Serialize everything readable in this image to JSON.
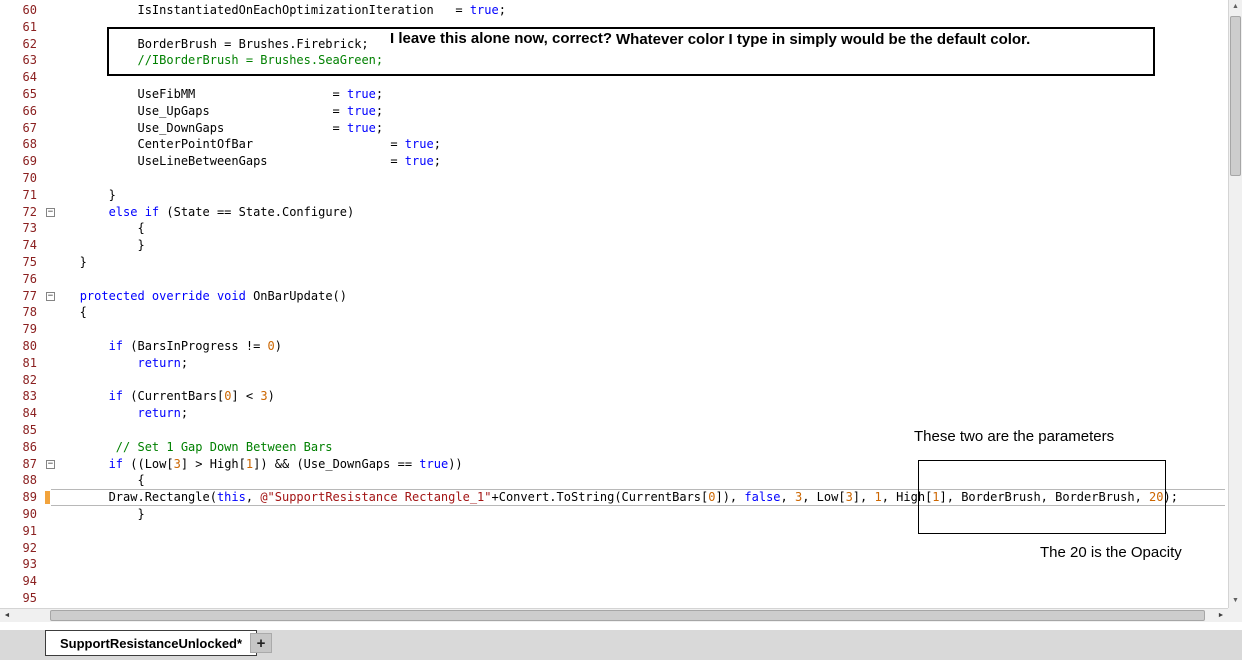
{
  "colors": {
    "keyword": "#0000ff",
    "comment": "#008000",
    "string": "#a31515",
    "number": "#cc6600",
    "line_number": "#8b2020",
    "change_marker": "#f2a33c",
    "annotation_border": "#000000"
  },
  "icons": {
    "up": "▲",
    "down": "▼",
    "left": "◄",
    "right": "►",
    "fold_collapse": "−"
  },
  "tab_bar": {
    "tab_label": "SupportResistanceUnlocked*",
    "new_tab_label": "+"
  },
  "annotations": {
    "note1a": "I leave this alone now, correct?",
    "note1b": "Whatever color I type in simply would be the default color.",
    "note2": "These two are the parameters",
    "note3": "The 20 is the Opacity"
  },
  "editor": {
    "current_line": 89,
    "changed_line": 89,
    "lines": [
      {
        "n": 60,
        "segs": [
          [
            "           IsInstantiatedOnEachOptimizationIteration   = ",
            "d"
          ],
          [
            "true",
            "k"
          ],
          [
            ";",
            "d"
          ]
        ]
      },
      {
        "n": 61,
        "segs": []
      },
      {
        "n": 62,
        "segs": [
          [
            "           BorderBrush = Brushes.Firebrick;",
            "d"
          ]
        ]
      },
      {
        "n": 63,
        "segs": [
          [
            "           ",
            "d"
          ],
          [
            "//IBorderBrush = Brushes.SeaGreen;",
            "c"
          ]
        ]
      },
      {
        "n": 64,
        "segs": []
      },
      {
        "n": 65,
        "segs": [
          [
            "           UseFibMM                   = ",
            "d"
          ],
          [
            "true",
            "k"
          ],
          [
            ";",
            "d"
          ]
        ]
      },
      {
        "n": 66,
        "segs": [
          [
            "           Use_UpGaps                 = ",
            "d"
          ],
          [
            "true",
            "k"
          ],
          [
            ";",
            "d"
          ]
        ]
      },
      {
        "n": 67,
        "segs": [
          [
            "           Use_DownGaps               = ",
            "d"
          ],
          [
            "true",
            "k"
          ],
          [
            ";",
            "d"
          ]
        ]
      },
      {
        "n": 68,
        "segs": [
          [
            "           CenterPointOfBar                   = ",
            "d"
          ],
          [
            "true",
            "k"
          ],
          [
            ";",
            "d"
          ]
        ]
      },
      {
        "n": 69,
        "segs": [
          [
            "           UseLineBetweenGaps                 = ",
            "d"
          ],
          [
            "true",
            "k"
          ],
          [
            ";",
            "d"
          ]
        ]
      },
      {
        "n": 70,
        "segs": []
      },
      {
        "n": 71,
        "segs": [
          [
            "       }",
            "d"
          ]
        ]
      },
      {
        "n": 72,
        "fold": true,
        "segs": [
          [
            "       ",
            "d"
          ],
          [
            "else if",
            "k"
          ],
          [
            " (State == State.Configure)",
            "d"
          ]
        ]
      },
      {
        "n": 73,
        "segs": [
          [
            "           {",
            "d"
          ]
        ]
      },
      {
        "n": 74,
        "segs": [
          [
            "           }",
            "d"
          ]
        ]
      },
      {
        "n": 75,
        "segs": [
          [
            "   }",
            "d"
          ]
        ]
      },
      {
        "n": 76,
        "segs": []
      },
      {
        "n": 77,
        "fold": true,
        "segs": [
          [
            "   ",
            "d"
          ],
          [
            "protected override void",
            "k"
          ],
          [
            " OnBarUpdate()",
            "d"
          ]
        ]
      },
      {
        "n": 78,
        "segs": [
          [
            "   {",
            "d"
          ]
        ]
      },
      {
        "n": 79,
        "segs": []
      },
      {
        "n": 80,
        "segs": [
          [
            "       ",
            "d"
          ],
          [
            "if",
            "k"
          ],
          [
            " (BarsInProgress != ",
            "d"
          ],
          [
            "0",
            "n"
          ],
          [
            ")",
            "d"
          ]
        ]
      },
      {
        "n": 81,
        "segs": [
          [
            "           ",
            "d"
          ],
          [
            "return",
            "k"
          ],
          [
            ";",
            "d"
          ]
        ]
      },
      {
        "n": 82,
        "segs": []
      },
      {
        "n": 83,
        "segs": [
          [
            "       ",
            "d"
          ],
          [
            "if",
            "k"
          ],
          [
            " (CurrentBars[",
            "d"
          ],
          [
            "0",
            "n"
          ],
          [
            "] < ",
            "d"
          ],
          [
            "3",
            "n"
          ],
          [
            ")",
            "d"
          ]
        ]
      },
      {
        "n": 84,
        "segs": [
          [
            "           ",
            "d"
          ],
          [
            "return",
            "k"
          ],
          [
            ";",
            "d"
          ]
        ]
      },
      {
        "n": 85,
        "segs": []
      },
      {
        "n": 86,
        "segs": [
          [
            "        ",
            "d"
          ],
          [
            "// Set 1 Gap Down Between Bars",
            "c"
          ]
        ]
      },
      {
        "n": 87,
        "fold": true,
        "segs": [
          [
            "       ",
            "d"
          ],
          [
            "if",
            "k"
          ],
          [
            " ((Low[",
            "d"
          ],
          [
            "3",
            "n"
          ],
          [
            "] > High[",
            "d"
          ],
          [
            "1",
            "n"
          ],
          [
            "]) && (Use_DownGaps == ",
            "d"
          ],
          [
            "true",
            "k"
          ],
          [
            "))",
            "d"
          ]
        ]
      },
      {
        "n": 88,
        "segs": [
          [
            "           {",
            "d"
          ]
        ]
      },
      {
        "n": 89,
        "segs": [
          [
            "       Draw.Rectangle(",
            "d"
          ],
          [
            "this",
            "k"
          ],
          [
            ", ",
            "d"
          ],
          [
            "@\"SupportResistance Rectangle_1\"",
            "s"
          ],
          [
            "+Convert.ToString(CurrentBars[",
            "d"
          ],
          [
            "0",
            "n"
          ],
          [
            "]), ",
            "d"
          ],
          [
            "false",
            "k"
          ],
          [
            ", ",
            "d"
          ],
          [
            "3",
            "n"
          ],
          [
            ", Low[",
            "d"
          ],
          [
            "3",
            "n"
          ],
          [
            "], ",
            "d"
          ],
          [
            "1",
            "n"
          ],
          [
            ", High[",
            "d"
          ],
          [
            "1",
            "n"
          ],
          [
            "], BorderBrush, BorderBrush, ",
            "d"
          ],
          [
            "20",
            "n"
          ],
          [
            ");",
            "d"
          ]
        ]
      },
      {
        "n": 90,
        "segs": [
          [
            "           }",
            "d"
          ]
        ]
      },
      {
        "n": 91,
        "segs": []
      },
      {
        "n": 92,
        "segs": []
      },
      {
        "n": 93,
        "segs": []
      },
      {
        "n": 94,
        "segs": []
      },
      {
        "n": 95,
        "segs": []
      }
    ]
  }
}
